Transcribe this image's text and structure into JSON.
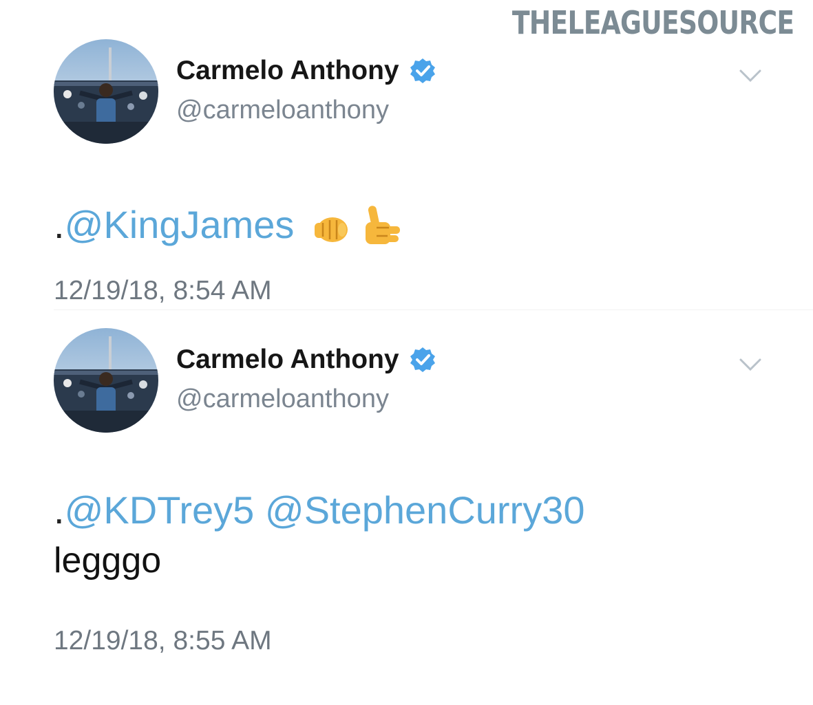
{
  "watermark": "THELEAGUESOURCE",
  "tweets": [
    {
      "display_name": "Carmelo Anthony",
      "handle": "@carmeloanthony",
      "verified": true,
      "text_prefix": ".",
      "mentions": [
        "@KingJames"
      ],
      "emojis": [
        "fist-bump-emoji",
        "call-me-hand-emoji"
      ],
      "body": "",
      "timestamp": "12/19/18, 8:54 AM"
    },
    {
      "display_name": "Carmelo Anthony",
      "handle": "@carmeloanthony",
      "verified": true,
      "text_prefix": ".",
      "mentions": [
        "@KDTrey5",
        "@StephenCurry30"
      ],
      "emojis": [],
      "body": "legggo",
      "timestamp": "12/19/18, 8:55 AM"
    }
  ],
  "colors": {
    "mention": "#5ba7d9",
    "verified": "#4aa3ea",
    "secondary_text": "#7b8590",
    "watermark": "#7c8b94"
  },
  "icons": {
    "verified": "verified-badge-icon",
    "menu": "chevron-down-icon"
  }
}
